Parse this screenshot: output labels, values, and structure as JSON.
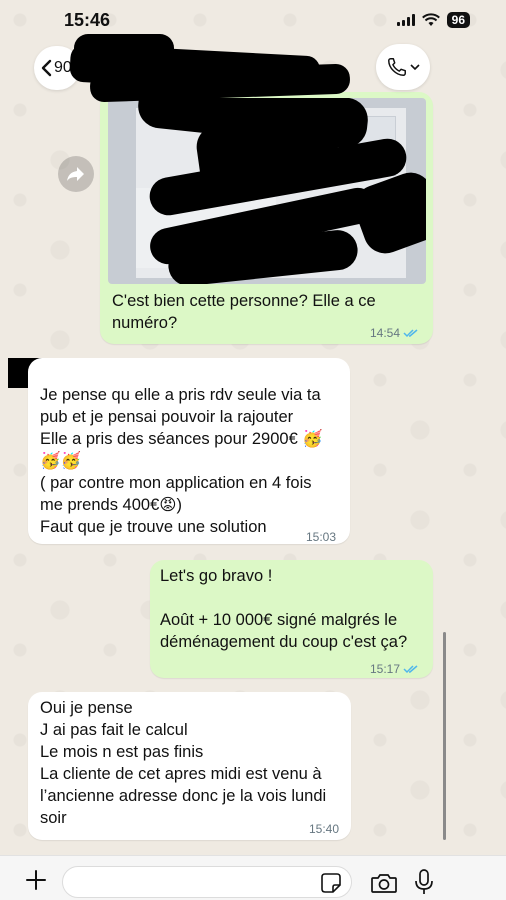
{
  "status_bar": {
    "time": "15:46",
    "battery": "96"
  },
  "header": {
    "back_label": "90"
  },
  "messages": [
    {
      "direction": "outgoing",
      "has_image": true,
      "lines": [
        "C'est bien cette personne? Elle a ce",
        "numéro?"
      ],
      "time": "14:54",
      "read": true
    },
    {
      "direction": "incoming",
      "lines": [
        "Je pense qu elle a pris rdv seule via ta",
        "pub et je pensai pouvoir la rajouter",
        "Elle a pris des séances pour 2900€ 🥳",
        "🥳🥳",
        "( par contre mon application en 4 fois",
        "me prends 400€😡)",
        "Faut que je trouve une solution"
      ],
      "time": "15:03"
    },
    {
      "direction": "outgoing",
      "lines": [
        "Let's go bravo !",
        "",
        "Août + 10 000€ signé malgrés le",
        "déménagement du coup c'est ça?"
      ],
      "time": "15:17",
      "read": true
    },
    {
      "direction": "incoming",
      "lines": [
        "Oui je pense",
        "J ai pas fait le calcul",
        "Le mois n est pas finis",
        "La cliente de cet apres midi est venu à",
        "l’ancienne adresse donc je la vois lundi",
        "soir"
      ],
      "time": "15:40"
    }
  ],
  "input": {
    "placeholder": ""
  },
  "colors": {
    "outgoing_bubble": "#dcf8c6",
    "incoming_bubble": "#ffffff",
    "read_ticks": "#4fb6ec",
    "background": "#efeae2"
  },
  "icons": [
    "back-chevron-icon",
    "phone-icon",
    "forward-icon",
    "plus-icon",
    "sticker-icon",
    "camera-icon",
    "mic-icon"
  ]
}
